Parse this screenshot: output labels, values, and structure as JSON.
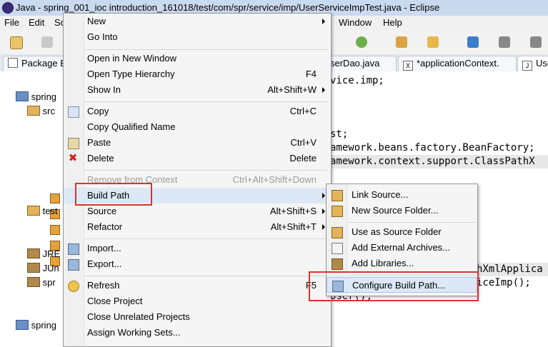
{
  "window": {
    "title": "Java - spring_001_ioc introduction_161018/test/com/spr/service/imp/UserServiceImpTest.java - Eclipse"
  },
  "menubar": {
    "file": "File",
    "edit": "Edit",
    "source_partial": "So",
    "window": "Window",
    "help": "Help"
  },
  "tabs": {
    "package_explorer": "Package E",
    "user_dao": "serDao.java",
    "app_context": "*applicationContext.",
    "user_service_partial": "Use"
  },
  "explorer": {
    "items": [
      "spring",
      "src",
      "test",
      "JRE",
      "JUn",
      "spr",
      "spring"
    ]
  },
  "editor": {
    "lines": [
      "vice.imp;",
      "st;",
      "amework.beans.factory.BeanFactory;",
      "amework.context.support.ClassPathX",
      "hXmlApplica",
      "iceImp();",
      "User();"
    ]
  },
  "context_menu": {
    "new": "New",
    "go_into": "Go Into",
    "open_new_window": "Open in New Window",
    "open_type_hierarchy": "Open Type Hierarchy",
    "open_type_hierarchy_acc": "F4",
    "show_in": "Show In",
    "show_in_acc": "Alt+Shift+W",
    "copy": "Copy",
    "copy_acc": "Ctrl+C",
    "copy_qualified": "Copy Qualified Name",
    "paste": "Paste",
    "paste_acc": "Ctrl+V",
    "delete": "Delete",
    "delete_acc": "Delete",
    "remove_context": "Remove from Context",
    "remove_context_acc": "Ctrl+Alt+Shift+Down",
    "build_path": "Build Path",
    "source": "Source",
    "source_acc": "Alt+Shift+S",
    "refactor": "Refactor",
    "refactor_acc": "Alt+Shift+T",
    "import": "Import...",
    "export": "Export...",
    "refresh": "Refresh",
    "refresh_acc": "F5",
    "close_project": "Close Project",
    "close_unrelated": "Close Unrelated Projects",
    "assign_working_sets": "Assign Working Sets..."
  },
  "submenu": {
    "link_source": "Link Source...",
    "new_source_folder": "New Source Folder...",
    "use_as_source_folder": "Use as Source Folder",
    "add_external_archives": "Add External Archives...",
    "add_libraries": "Add Libraries...",
    "configure_build_path": "Configure Build Path..."
  },
  "colors": {
    "highlight_box": "#e0312b",
    "hover": "#dce8f6",
    "title_bar": "#c9d9ee"
  }
}
